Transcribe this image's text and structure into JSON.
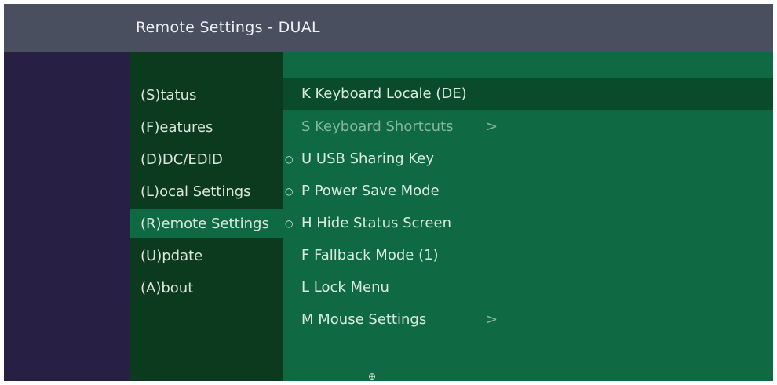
{
  "window": {
    "title": "Remote Settings - DUAL"
  },
  "sidebar": {
    "items": [
      {
        "label": "(S)tatus"
      },
      {
        "label": "(F)eatures"
      },
      {
        "label": "(D)DC/EDID"
      },
      {
        "label": "(L)ocal  Settings"
      },
      {
        "label": "(R)emote Settings",
        "selected": true
      },
      {
        "label": "(U)pdate"
      },
      {
        "label": "(A)bout"
      }
    ]
  },
  "options": {
    "items": [
      {
        "label": "K Keyboard Locale (DE)",
        "selected": true
      },
      {
        "label": "S Keyboard Shortcuts",
        "submenu": ">",
        "dim": true
      },
      {
        "label": "U USB Sharing Key",
        "marker": "○"
      },
      {
        "label": "P Power Save Mode",
        "marker": "○"
      },
      {
        "label": "H Hide Status Screen",
        "marker": "○"
      },
      {
        "label": "F Fallback Mode (1)"
      },
      {
        "label": "L Lock Menu"
      },
      {
        "label": "M Mouse Settings",
        "submenu": ">"
      }
    ],
    "footer_icon": "⊕"
  },
  "colors": {
    "background": "#271f44",
    "titlebar": "#4a4f60",
    "sidebar": "#0c3a1f",
    "accent": "#0f6a43",
    "option_selected": "#0a4b2b"
  }
}
